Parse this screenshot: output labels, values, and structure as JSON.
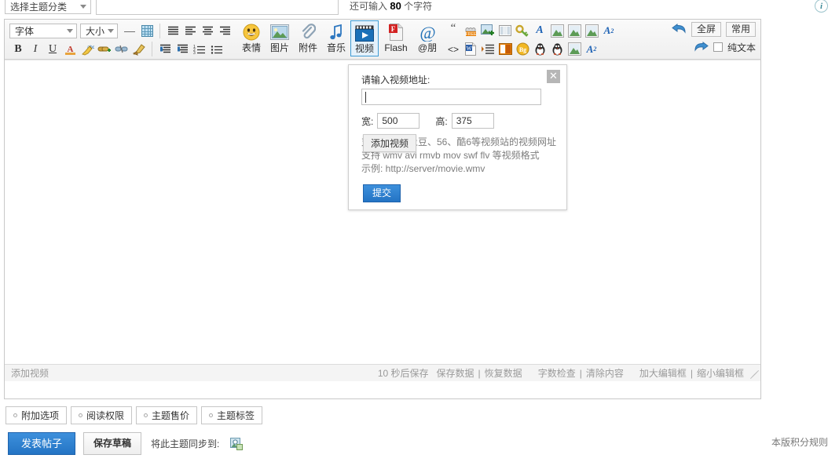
{
  "subject_bar": {
    "category_label": "选择主题分类",
    "subject_value": "",
    "charcount_prefix": "还可输入",
    "charcount_number": "80",
    "charcount_suffix": "个字符",
    "info_icon": "info-icon",
    "info_glyph": "i"
  },
  "toolbar": {
    "font_label": "字体",
    "size_label": "大小",
    "removeformat_glyph": "—",
    "row1_icons": [
      {
        "name": "table-icon",
        "glyph": "▦"
      },
      {
        "name": "align-justify-icon",
        "glyph": "≣"
      },
      {
        "name": "align-left-icon",
        "glyph": "≣"
      },
      {
        "name": "align-center-icon",
        "glyph": "≣"
      },
      {
        "name": "align-right-icon",
        "glyph": "≣"
      }
    ],
    "row2_icons": [
      {
        "name": "bold-icon",
        "glyph": "B"
      },
      {
        "name": "italic-icon",
        "glyph": "I"
      },
      {
        "name": "underline-icon",
        "glyph": "U"
      },
      {
        "name": "text-color-icon",
        "glyph": "A"
      },
      {
        "name": "highlight-icon",
        "glyph": "abc"
      },
      {
        "name": "insert-link-icon",
        "glyph": "link"
      },
      {
        "name": "remove-link-icon",
        "glyph": "unlink"
      },
      {
        "name": "clear-format-icon",
        "glyph": "broom"
      },
      {
        "name": "indent-increase-icon",
        "glyph": "≣"
      },
      {
        "name": "indent-decrease-icon",
        "glyph": "≣"
      },
      {
        "name": "ordered-list-icon",
        "glyph": "1."
      },
      {
        "name": "unordered-list-icon",
        "glyph": "•"
      }
    ],
    "big_buttons": [
      {
        "name": "smiley-button",
        "label": "表情",
        "icon": "smiley-icon",
        "active": false
      },
      {
        "name": "image-button",
        "label": "图片",
        "icon": "picture-icon",
        "active": false
      },
      {
        "name": "attachment-button",
        "label": "附件",
        "icon": "paperclip-icon",
        "active": false
      },
      {
        "name": "music-button",
        "label": "音乐",
        "icon": "music-note-icon",
        "active": false
      },
      {
        "name": "video-button",
        "label": "视频",
        "icon": "video-clapper-icon",
        "active": true
      },
      {
        "name": "flash-button",
        "label": "Flash",
        "icon": "flash-file-icon",
        "active": false
      },
      {
        "name": "mention-button",
        "label": "@朋",
        "icon": "at-sign-icon",
        "active": false
      }
    ],
    "extra_row1": [
      {
        "name": "quote-icon",
        "glyph": "“"
      },
      {
        "name": "free-stamp-icon",
        "glyph": "FREE"
      },
      {
        "name": "image-export-icon",
        "glyph": "img"
      },
      {
        "name": "columns-icon",
        "glyph": "▥"
      },
      {
        "name": "key-icon",
        "glyph": "key"
      },
      {
        "name": "bold-blue-a-icon",
        "glyph": "A"
      },
      {
        "name": "insert-image-1-icon",
        "glyph": "img"
      },
      {
        "name": "insert-image-2-icon",
        "glyph": "img"
      },
      {
        "name": "insert-image-3-icon",
        "glyph": "img"
      },
      {
        "name": "superscript-icon",
        "glyph": "A²"
      }
    ],
    "extra_row2": [
      {
        "name": "source-code-icon",
        "glyph": "<>"
      },
      {
        "name": "word-paste-icon",
        "glyph": "W"
      },
      {
        "name": "paragraph-format-icon",
        "glyph": "¶"
      },
      {
        "name": "book-icon",
        "glyph": "book"
      },
      {
        "name": "background-icon",
        "glyph": "Bg"
      },
      {
        "name": "qq-icon-1",
        "glyph": "QQ"
      },
      {
        "name": "qq-icon-2",
        "glyph": "QQ"
      },
      {
        "name": "insert-image-4-icon",
        "glyph": "img"
      },
      {
        "name": "subscript-icon",
        "glyph": "A₂"
      }
    ],
    "undo_icon": "undo-arrow-icon",
    "redo_icon": "redo-arrow-icon",
    "fullscreen_label": "全屏",
    "common_label": "常用",
    "plaintext_label": "纯文本",
    "plaintext_checked": false
  },
  "editor_body": {
    "content": ""
  },
  "statusbar": {
    "left_text": "添加视频",
    "autosave_text": "10 秒后保存",
    "save_data": "保存数据",
    "restore_data": "恢复数据",
    "word_check": "字数检查",
    "clear_content": "清除内容",
    "enlarge_editor": "加大编辑框",
    "shrink_editor": "缩小编辑框",
    "divider": "|",
    "grip_icon": "resize-grip-icon"
  },
  "dialog": {
    "title_tooltip": "添加视频",
    "label": "请输入视频地址:",
    "url_value": "",
    "width_label": "宽:",
    "width_value": "500",
    "height_label": "高:",
    "height_value": "375",
    "help_line1": "支持优酷、土豆、56、酷6等视频站的视频网址",
    "help_line2": "支持 wmv avi rmvb mov swf flv 等视频格式",
    "help_line3": "示例: http://server/movie.wmv",
    "submit_label": "提交",
    "close_glyph": "✕",
    "close_icon": "close-icon"
  },
  "pills": [
    {
      "name": "extra-options-pill",
      "label": "附加选项"
    },
    {
      "name": "read-permission-pill",
      "label": "阅读权限"
    },
    {
      "name": "topic-price-pill",
      "label": "主题售价"
    },
    {
      "name": "topic-tag-pill",
      "label": "主题标签"
    }
  ],
  "actions": {
    "post_label": "发表帖子",
    "draft_label": "保存草稿",
    "sync_text": "将此主题同步到:",
    "sync_icon": "sync-share-icon",
    "rules_label": "本版积分规则"
  },
  "colors": {
    "accent_blue": "#2f7fd0",
    "active_border": "#3d9bd4",
    "active_bg": "#e4f1fb",
    "toolbar_bg": "#f1f1f1",
    "muted_text": "#9a9a9a"
  }
}
